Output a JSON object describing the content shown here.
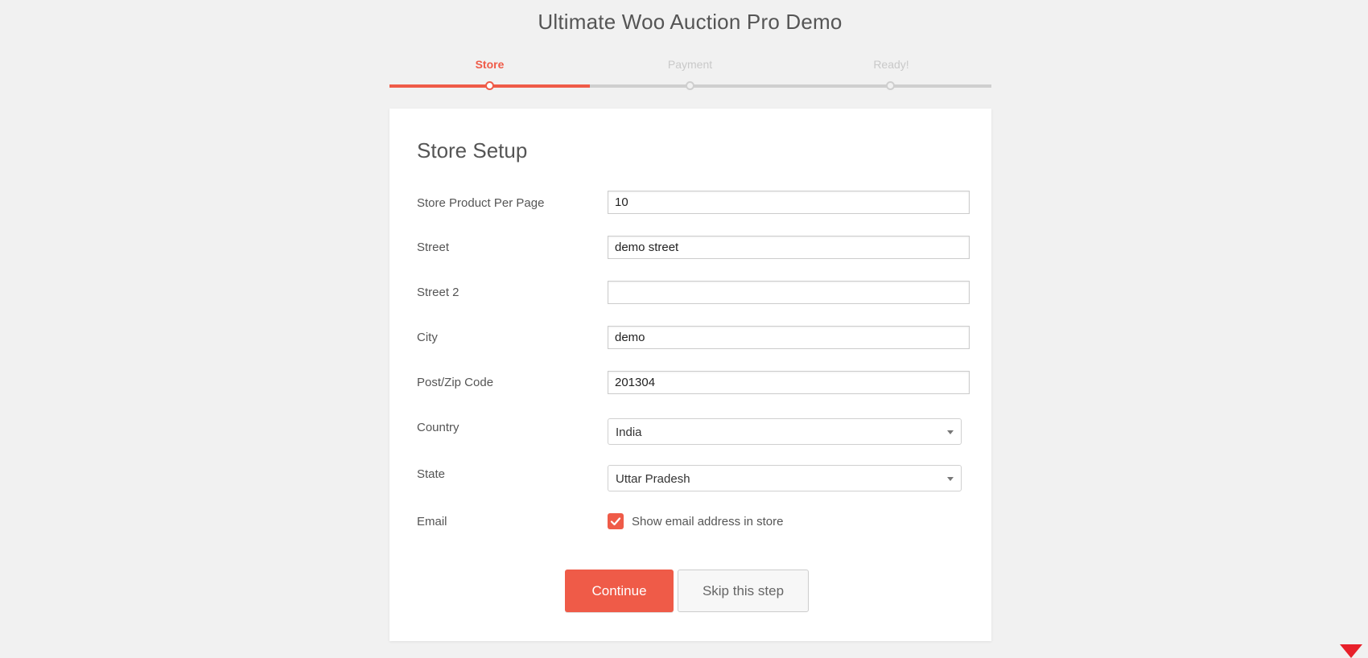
{
  "header": {
    "title": "Ultimate Woo Auction Pro Demo"
  },
  "steps": [
    {
      "label": "Store",
      "active": true
    },
    {
      "label": "Payment",
      "active": false
    },
    {
      "label": "Ready!",
      "active": false
    }
  ],
  "accent_color": "#ef5b48",
  "form": {
    "title": "Store Setup",
    "products_per_page": {
      "label": "Store Product Per Page",
      "value": "10"
    },
    "street": {
      "label": "Street",
      "value": "demo street"
    },
    "street2": {
      "label": "Street 2",
      "value": ""
    },
    "city": {
      "label": "City",
      "value": "demo"
    },
    "zip": {
      "label": "Post/Zip Code",
      "value": "201304"
    },
    "country": {
      "label": "Country",
      "value": "India"
    },
    "state": {
      "label": "State",
      "value": "Uttar Pradesh"
    },
    "email": {
      "label": "Email",
      "checkbox_label": "Show email address in store",
      "checked": true
    }
  },
  "actions": {
    "continue_label": "Continue",
    "skip_label": "Skip this step"
  },
  "icons": {
    "checkbox": "checkmark-icon",
    "select_arrow": "caret-down-icon",
    "corner": "red-triangle-down-icon"
  }
}
